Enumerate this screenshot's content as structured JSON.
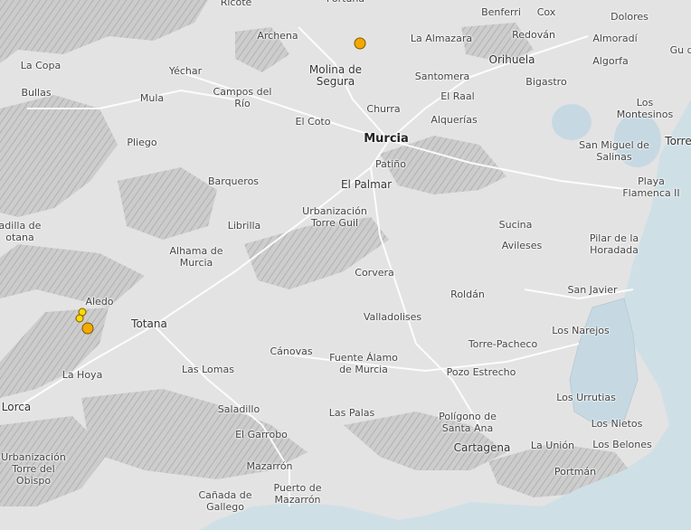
{
  "map": {
    "colors": {
      "land": "#e3e3e3",
      "sea": "#cfdfe6",
      "lagoon": "#c6d9e2",
      "relief": "#b9b9b9",
      "road": "#ffffff"
    },
    "labels": [
      {
        "id": "ricote",
        "text": "Ricote",
        "kind": "place"
      },
      {
        "id": "fortuna",
        "text": "Fortuna",
        "kind": "place"
      },
      {
        "id": "benferri",
        "text": "Benferri",
        "kind": "place"
      },
      {
        "id": "cox",
        "text": "Cox",
        "kind": "place"
      },
      {
        "id": "dolores",
        "text": "Dolores",
        "kind": "place"
      },
      {
        "id": "archena",
        "text": "Archena",
        "kind": "place"
      },
      {
        "id": "la-almazara",
        "text": "La Almazara",
        "kind": "place"
      },
      {
        "id": "redovan",
        "text": "Redován",
        "kind": "place"
      },
      {
        "id": "almoradi",
        "text": "Almoradí",
        "kind": "place"
      },
      {
        "id": "guardamar",
        "text": "Gu de",
        "kind": "place"
      },
      {
        "id": "la-copa",
        "text": "La Copa",
        "kind": "place"
      },
      {
        "id": "yechar",
        "text": "Yéchar",
        "kind": "place"
      },
      {
        "id": "molina",
        "text": "Molina de\nSegura",
        "kind": "town"
      },
      {
        "id": "orihuela",
        "text": "Orihuela",
        "kind": "town"
      },
      {
        "id": "algorfa",
        "text": "Algorfa",
        "kind": "place"
      },
      {
        "id": "santomera",
        "text": "Santomera",
        "kind": "place"
      },
      {
        "id": "bullas",
        "text": "Bullas",
        "kind": "place"
      },
      {
        "id": "mula",
        "text": "Mula",
        "kind": "place"
      },
      {
        "id": "campos-del-rio",
        "text": "Campos del\nRío",
        "kind": "place"
      },
      {
        "id": "el-raal",
        "text": "El Raal",
        "kind": "place"
      },
      {
        "id": "bigastro",
        "text": "Bigastro",
        "kind": "place"
      },
      {
        "id": "los-montesinos",
        "text": "Los\nMontesinos",
        "kind": "place"
      },
      {
        "id": "churra",
        "text": "Churra",
        "kind": "place"
      },
      {
        "id": "el-coto",
        "text": "El Coto",
        "kind": "place"
      },
      {
        "id": "alquerias",
        "text": "Alquerías",
        "kind": "place"
      },
      {
        "id": "pliego",
        "text": "Pliego",
        "kind": "place"
      },
      {
        "id": "murcia",
        "text": "Murcia",
        "kind": "city"
      },
      {
        "id": "torrevieja",
        "text": "Torre",
        "kind": "town"
      },
      {
        "id": "san-miguel",
        "text": "San Miguel de\nSalinas",
        "kind": "place"
      },
      {
        "id": "patino",
        "text": "Patiño",
        "kind": "place"
      },
      {
        "id": "barqueros",
        "text": "Barqueros",
        "kind": "place"
      },
      {
        "id": "el-palmar",
        "text": "El Palmar",
        "kind": "town"
      },
      {
        "id": "playa-flamenca",
        "text": "Playa\nFlamenca II",
        "kind": "place"
      },
      {
        "id": "zarcilla",
        "text": "adilla de\notana",
        "kind": "place"
      },
      {
        "id": "urb-torre-guil",
        "text": "Urbanización\nTorre Guil",
        "kind": "place"
      },
      {
        "id": "librilla",
        "text": "Librilla",
        "kind": "place"
      },
      {
        "id": "sucina",
        "text": "Sucina",
        "kind": "place"
      },
      {
        "id": "alhama",
        "text": "Alhama de\nMurcia",
        "kind": "place"
      },
      {
        "id": "avileses",
        "text": "Avileses",
        "kind": "place"
      },
      {
        "id": "pilar-horadada",
        "text": "Pilar de la\nHoradada",
        "kind": "place"
      },
      {
        "id": "corvera",
        "text": "Corvera",
        "kind": "place"
      },
      {
        "id": "san-javier",
        "text": "San Javier",
        "kind": "place"
      },
      {
        "id": "roldan",
        "text": "Roldán",
        "kind": "place"
      },
      {
        "id": "aledo",
        "text": "Aledo",
        "kind": "place"
      },
      {
        "id": "valladolises",
        "text": "Valladolises",
        "kind": "place"
      },
      {
        "id": "totana",
        "text": "Totana",
        "kind": "town"
      },
      {
        "id": "los-narejos",
        "text": "Los Narejos",
        "kind": "place"
      },
      {
        "id": "torre-pacheco",
        "text": "Torre-Pacheco",
        "kind": "place"
      },
      {
        "id": "canovas",
        "text": "Cánovas",
        "kind": "place"
      },
      {
        "id": "fuente-alamo",
        "text": "Fuente Álamo\nde Murcia",
        "kind": "place"
      },
      {
        "id": "la-hoya",
        "text": "La Hoya",
        "kind": "place"
      },
      {
        "id": "las-lomas",
        "text": "Las Lomas",
        "kind": "place"
      },
      {
        "id": "pozo-estrecho",
        "text": "Pozo Estrecho",
        "kind": "place"
      },
      {
        "id": "los-urrutias",
        "text": "Los Urrutias",
        "kind": "place"
      },
      {
        "id": "lorca",
        "text": "Lorca",
        "kind": "town"
      },
      {
        "id": "saladillo",
        "text": "Saladillo",
        "kind": "place"
      },
      {
        "id": "las-palas",
        "text": "Las Palas",
        "kind": "place"
      },
      {
        "id": "poligono",
        "text": "Polígono de\nSanta Ana",
        "kind": "place"
      },
      {
        "id": "los-nietos",
        "text": "Los Nietos",
        "kind": "place"
      },
      {
        "id": "el-garrobo",
        "text": "El Garrobo",
        "kind": "place"
      },
      {
        "id": "cartagena",
        "text": "Cartagena",
        "kind": "town"
      },
      {
        "id": "la-union",
        "text": "La Unión",
        "kind": "place"
      },
      {
        "id": "los-belones",
        "text": "Los Belones",
        "kind": "place"
      },
      {
        "id": "urb-torre-obispo",
        "text": "Urbanización\nTorre del\nObispo",
        "kind": "place"
      },
      {
        "id": "mazarron",
        "text": "Mazarrón",
        "kind": "place"
      },
      {
        "id": "portman",
        "text": "Portmán",
        "kind": "place"
      },
      {
        "id": "canada-gallego",
        "text": "Cañada de\nGallego",
        "kind": "place"
      },
      {
        "id": "puerto-mazarron",
        "text": "Puerto de\nMazarrón",
        "kind": "place"
      }
    ],
    "markers": [
      {
        "id": "molina",
        "color": "#f5a800",
        "size": "large"
      },
      {
        "id": "aledo-1",
        "color": "#ffd900",
        "size": "small"
      },
      {
        "id": "aledo-2",
        "color": "#ffd900",
        "size": "small"
      },
      {
        "id": "aledo-3",
        "color": "#f5a800",
        "size": "large"
      }
    ]
  }
}
